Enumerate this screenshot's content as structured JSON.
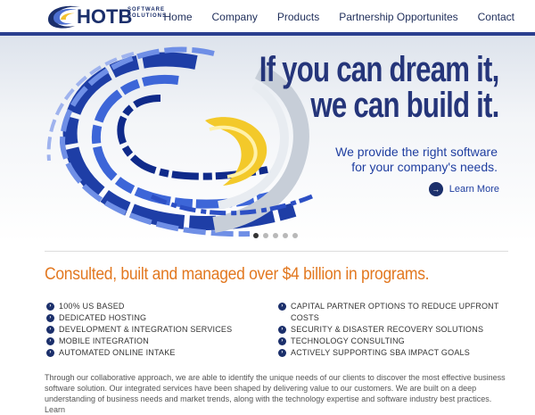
{
  "header": {
    "brand": "HOTB",
    "brand_sub_1": "SOFTWARE",
    "brand_sub_2": "SOLUTIONS",
    "nav": [
      "Home",
      "Company",
      "Products",
      "Partnership Opportunites",
      "Contact"
    ]
  },
  "hero": {
    "headline_1": "If you can dream it,",
    "headline_2": "we can build it.",
    "tagline_1": "We provide the right software",
    "tagline_2": "for your company's needs.",
    "learn_more": "Learn More",
    "slide_count": 5,
    "active_slide": 1
  },
  "main": {
    "title": "Consulted, built and managed over $4 billion in programs.",
    "left_list": [
      "100% US BASED",
      "DEDICATED HOSTING",
      "DEVELOPMENT & INTEGRATION SERVICES",
      "MOBILE INTEGRATION",
      "AUTOMATED ONLINE INTAKE"
    ],
    "right_list": [
      "CAPITAL PARTNER OPTIONS TO REDUCE UPFRONT COSTS",
      "SECURITY & DISASTER RECOVERY SOLUTIONS",
      "TECHNOLOGY CONSULTING",
      "ACTIVELY SUPPORTING SBA IMPACT GOALS"
    ],
    "paragraph": "Through our collaborative approach, we are able to identify the unique needs of our clients to discover the most effective business software solution. Our integrated services have been shaped by delivering value to our customers. We are built on a deep understanding of business needs and market trends, along with the technology expertise and software industry best practices. Learn"
  },
  "colors": {
    "navy": "#1b2f6b",
    "accent_orange": "#e27820",
    "link_blue": "#1f3ea0"
  }
}
